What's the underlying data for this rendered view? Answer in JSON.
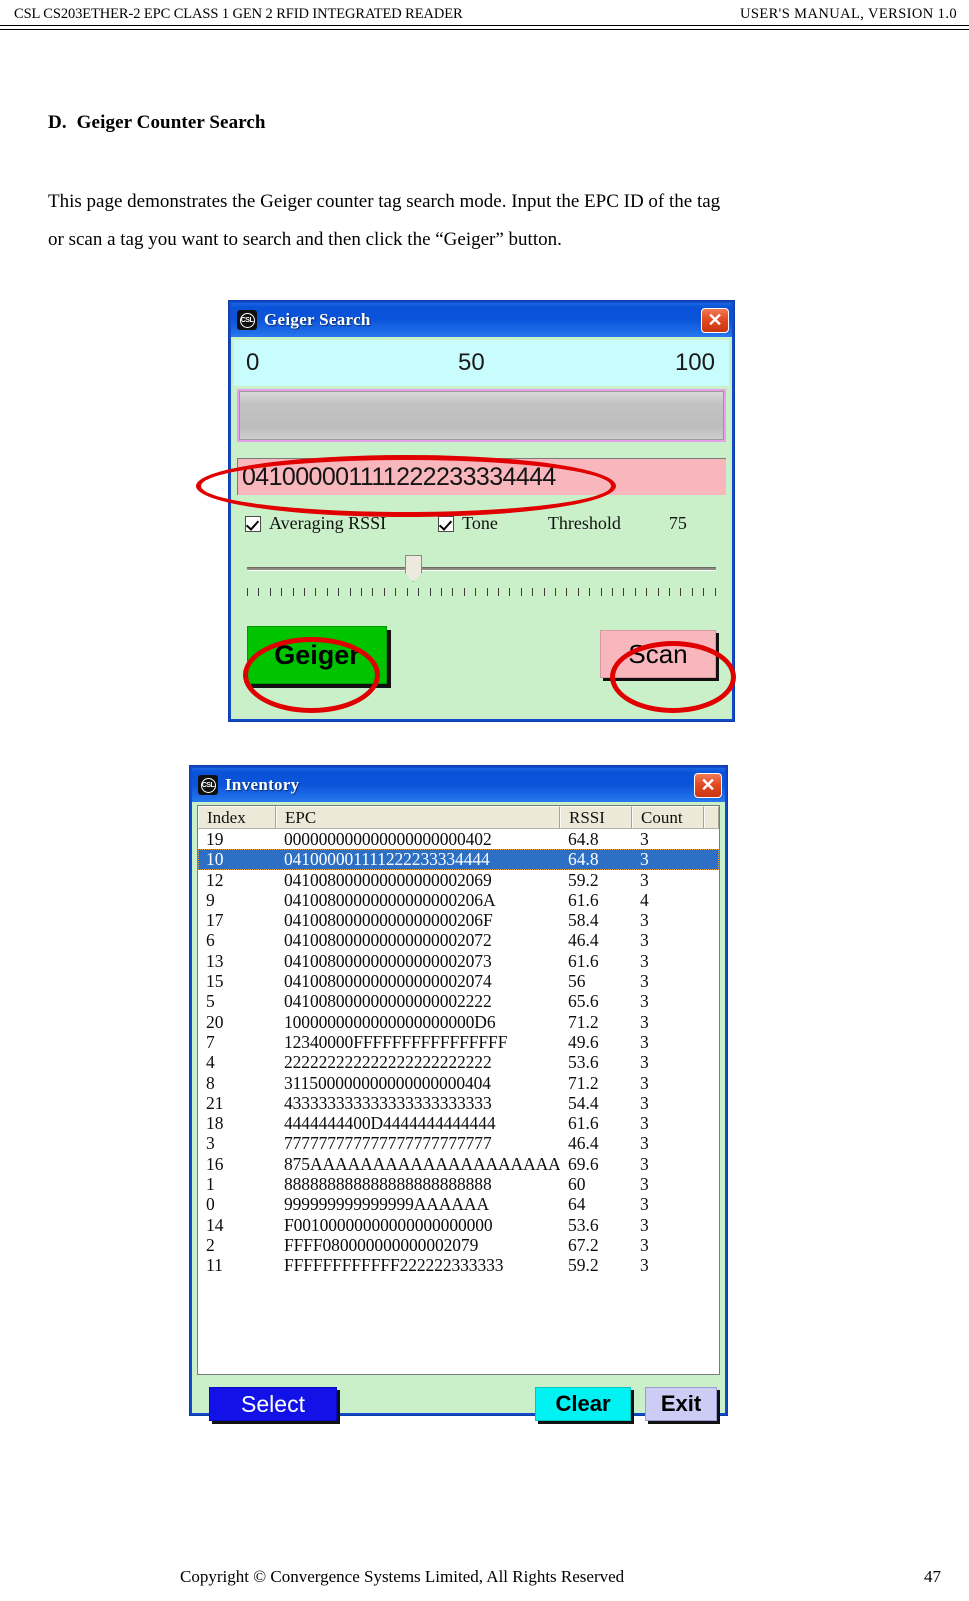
{
  "page_header": {
    "left": "CSL CS203ETHER-2 EPC CLASS 1 GEN 2 RFID INTEGRATED READER",
    "right": "USER'S  MANUAL,  VERSION  1.0"
  },
  "section": {
    "letter": "D.",
    "title": "Geiger Counter Search",
    "paragraph_line1": "This page demonstrates the Geiger counter tag search mode. Input the EPC ID of the tag",
    "paragraph_line2": "or scan a tag you want to search and then click the “Geiger” button."
  },
  "geiger_dialog": {
    "title": "Geiger Search",
    "logo_text": "CSL",
    "close_label": "✕",
    "scale": {
      "min": "0",
      "mid": "50",
      "max": "100"
    },
    "epc_value": "041000001111222233334444",
    "averaging_rssi_label": "Averaging RSSI",
    "averaging_rssi_checked": true,
    "tone_label": "Tone",
    "tone_checked": true,
    "threshold_label": "Threshold",
    "threshold_value": "75",
    "geiger_button": "Geiger",
    "scan_button": "Scan",
    "colors": {
      "scale_band": "#c8fcfd",
      "dialog_bg": "#c9f0c9",
      "epc_field": "#f7b7bd",
      "geiger_button": "#00c400",
      "scan_button": "#f7b7bd",
      "titlebar": "#0b53da",
      "annotation": "#e00000"
    }
  },
  "inventory_dialog": {
    "title": "Inventory",
    "logo_text": "CSL",
    "close_label": "✕",
    "columns": [
      "Index",
      "EPC",
      "RSSI",
      "Count"
    ],
    "selected_index": 1,
    "rows": [
      {
        "index": "19",
        "epc": "000000000000000000000402",
        "rssi": "64.8",
        "count": "3"
      },
      {
        "index": "10",
        "epc": "041000001111222233334444",
        "rssi": "64.8",
        "count": "3"
      },
      {
        "index": "12",
        "epc": "041008000000000000002069",
        "rssi": "59.2",
        "count": "3"
      },
      {
        "index": "9",
        "epc": "04100800000000000000206A",
        "rssi": "61.6",
        "count": "4"
      },
      {
        "index": "17",
        "epc": "04100800000000000000206F",
        "rssi": "58.4",
        "count": "3"
      },
      {
        "index": "6",
        "epc": "041008000000000000002072",
        "rssi": "46.4",
        "count": "3"
      },
      {
        "index": "13",
        "epc": "041008000000000000002073",
        "rssi": "61.6",
        "count": "3"
      },
      {
        "index": "15",
        "epc": "041008000000000000002074",
        "rssi": "56",
        "count": "3"
      },
      {
        "index": "5",
        "epc": "041008000000000000002222",
        "rssi": "65.6",
        "count": "3"
      },
      {
        "index": "20",
        "epc": "1000000000000000000000D6",
        "rssi": "71.2",
        "count": "3"
      },
      {
        "index": "7",
        "epc": "12340000FFFFFFFFFFFFFFFF",
        "rssi": "49.6",
        "count": "3"
      },
      {
        "index": "4",
        "epc": "222222222222222222222222",
        "rssi": "53.6",
        "count": "3"
      },
      {
        "index": "8",
        "epc": "311500000000000000000404",
        "rssi": "71.2",
        "count": "3"
      },
      {
        "index": "21",
        "epc": "433333333333333333333333",
        "rssi": "54.4",
        "count": "3"
      },
      {
        "index": "18",
        "epc": "4444444400D4444444444444",
        "rssi": "61.6",
        "count": "3"
      },
      {
        "index": "3",
        "epc": "777777777777777777777777",
        "rssi": "46.4",
        "count": "3"
      },
      {
        "index": "16",
        "epc": "875AAAAAAAAAAAAAAAAAAAAA",
        "rssi": "69.6",
        "count": "3"
      },
      {
        "index": "1",
        "epc": "888888888888888888888888",
        "rssi": "60",
        "count": "3"
      },
      {
        "index": "0",
        "epc": "999999999999999AAAAAA",
        "rssi": "64",
        "count": "3"
      },
      {
        "index": "14",
        "epc": "F00100000000000000000000",
        "rssi": "53.6",
        "count": "3"
      },
      {
        "index": "2",
        "epc": "FFFF080000000000002079",
        "rssi": "67.2",
        "count": "3"
      },
      {
        "index": "11",
        "epc": "FFFFFFFFFFFF222222333333",
        "rssi": "59.2",
        "count": "3"
      }
    ],
    "select_button": "Select",
    "clear_button": "Clear",
    "exit_button": "Exit",
    "colors": {
      "select_button": "#1212e8",
      "clear_button": "#00f2f2",
      "exit_button": "#ccccf5",
      "selected_row": "#2d6fc4"
    }
  },
  "footer": {
    "copyright": "Copyright © Convergence Systems Limited, All Rights Reserved",
    "page_number": "47"
  }
}
